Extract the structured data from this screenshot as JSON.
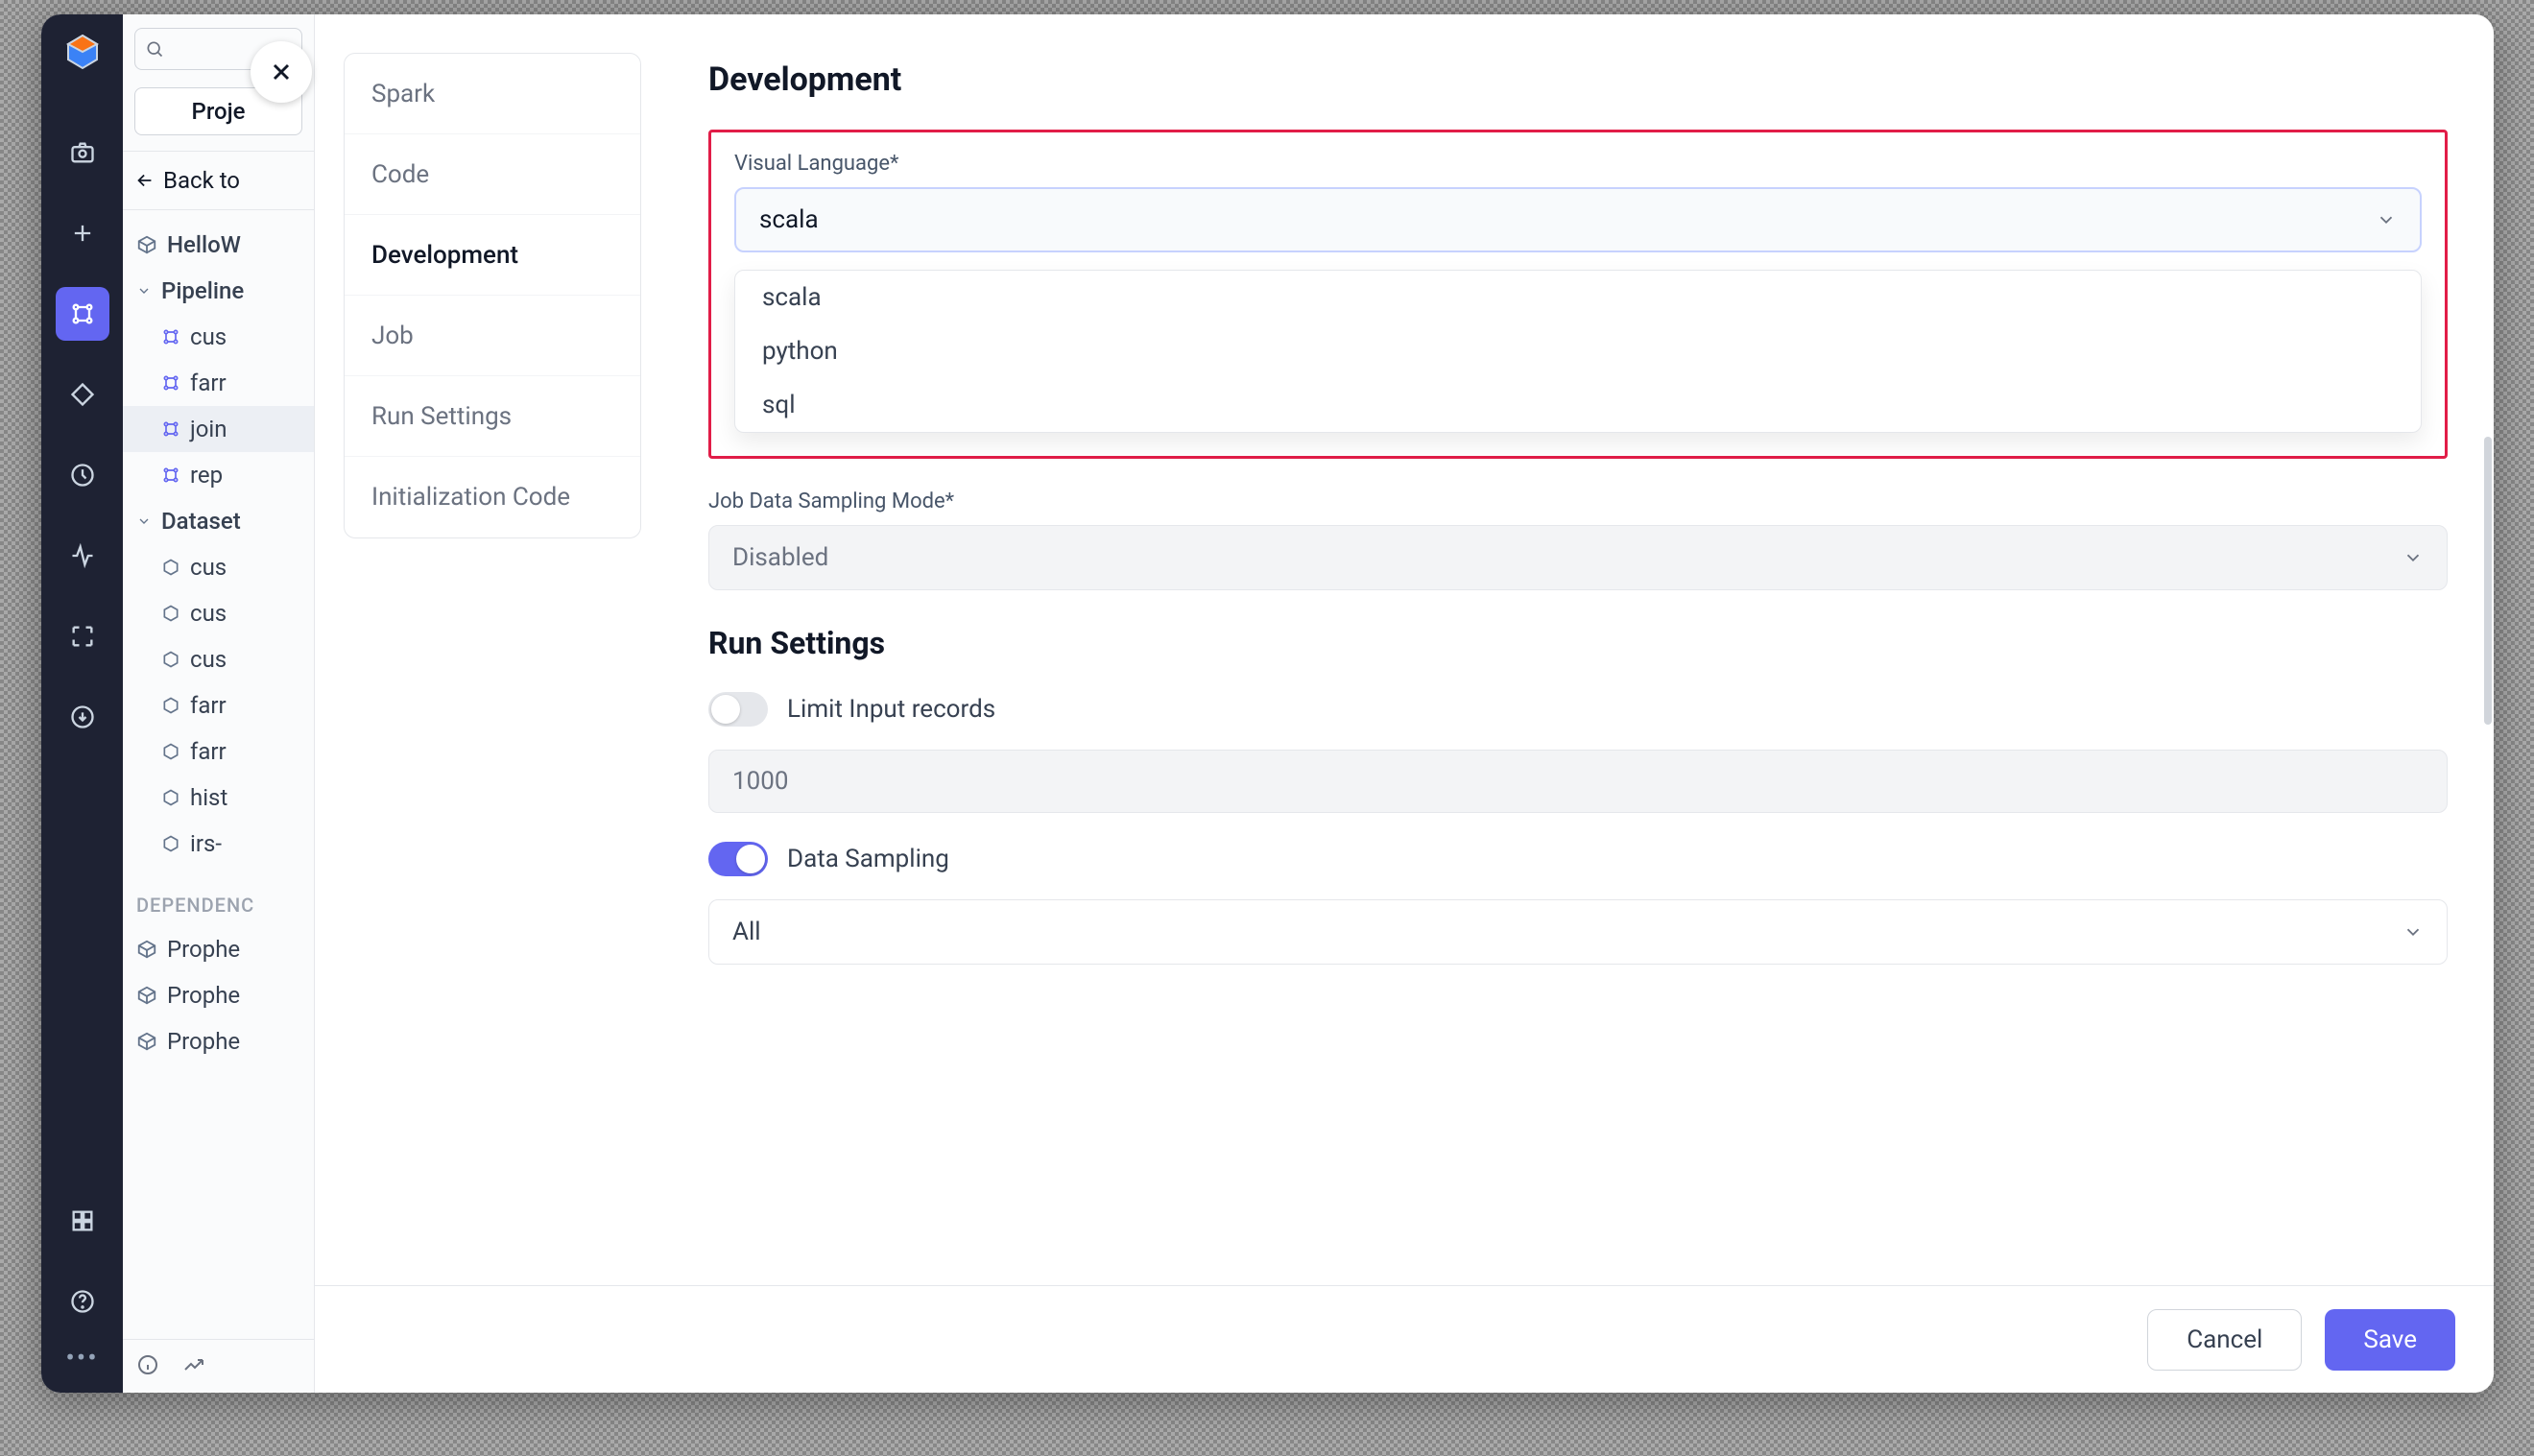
{
  "search": {
    "placeholder": ""
  },
  "proj_button": "Proje",
  "back_label": "Back to",
  "tree": {
    "root": "HelloW",
    "pipelines_label": "Pipeline",
    "pipelines": [
      "cus",
      "farr",
      "join",
      "rep"
    ],
    "datasets_label": "Dataset",
    "datasets": [
      "cus",
      "cus",
      "cus",
      "farr",
      "farr",
      "hist",
      "irs-"
    ]
  },
  "dependencies_label": "DEPENDENC",
  "deps": [
    "Prophe",
    "Prophe",
    "Prophe"
  ],
  "settings_nav": [
    "Spark",
    "Code",
    "Development",
    "Job",
    "Run Settings",
    "Initialization Code"
  ],
  "dev": {
    "title": "Development",
    "visual_lang_label": "Visual Language*",
    "visual_lang_value": "scala",
    "visual_lang_options": [
      "scala",
      "python",
      "sql"
    ],
    "job_sampling_label": "Job Data Sampling Mode*",
    "job_sampling_value": "Disabled"
  },
  "run": {
    "title": "Run Settings",
    "limit_label": "Limit Input records",
    "limit_value": "1000",
    "sampling_label": "Data Sampling",
    "sampling_select": "All"
  },
  "footer": {
    "cancel": "Cancel",
    "save": "Save"
  }
}
